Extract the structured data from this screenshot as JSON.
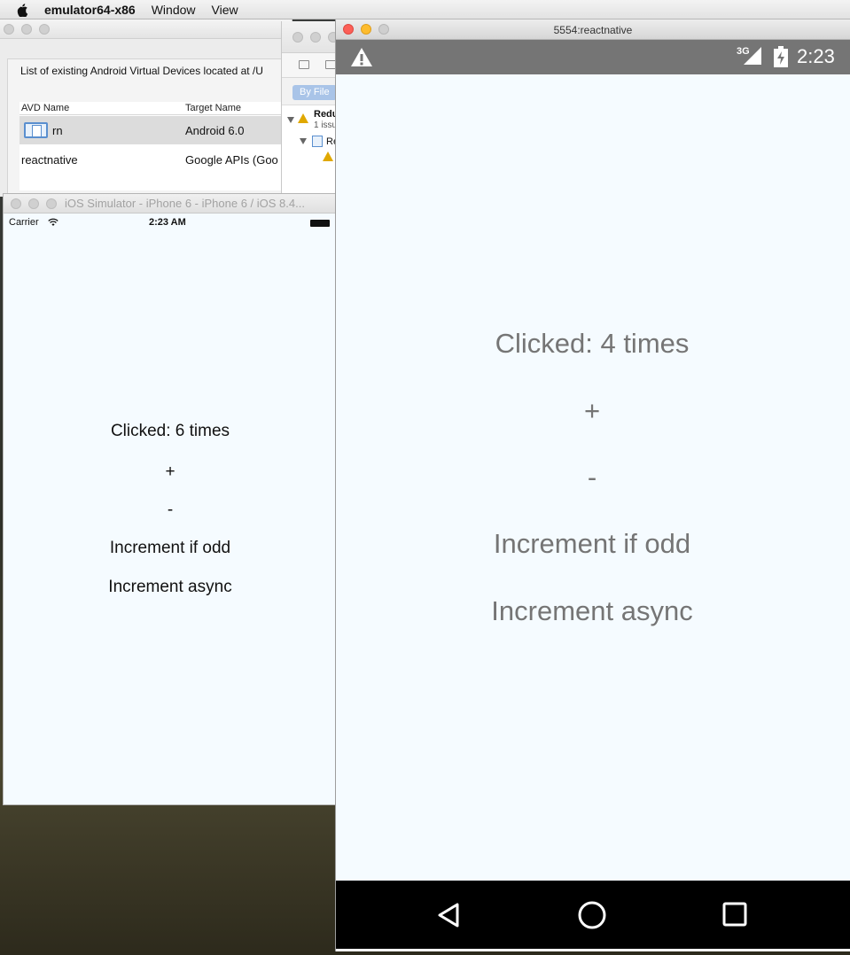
{
  "menubar": {
    "app_name": "emulator64-x86",
    "items": [
      "Window",
      "View"
    ]
  },
  "avd_manager": {
    "caption": "List of existing Android Virtual Devices located at /U",
    "columns": [
      "AVD Name",
      "Target Name"
    ],
    "rows": [
      {
        "name": "rn",
        "target": "Android 6.0"
      },
      {
        "name": "reactnative",
        "target": "Google APIs (Goo"
      }
    ]
  },
  "xcode": {
    "filter_label": "By File",
    "lines": [
      "Redu",
      "1 issu",
      "Re"
    ]
  },
  "ios_simulator": {
    "title": "iOS Simulator - iPhone 6 - iPhone 6 / iOS 8.4...",
    "carrier": "Carrier",
    "time": "2:23 AM",
    "clicked_text": "Clicked: 6 times",
    "plus_label": "+",
    "minus_label": "-",
    "increment_odd_label": "Increment if odd",
    "increment_async_label": "Increment async"
  },
  "android_emulator": {
    "title": "5554:reactnative",
    "network": "3G",
    "time": "2:23",
    "clicked_text": "Clicked: 4 times",
    "plus_label": "+",
    "minus_label": "-",
    "increment_odd_label": "Increment if odd",
    "increment_async_label": "Increment async",
    "nav_icons": [
      "back-icon",
      "home-icon",
      "recents-icon"
    ]
  },
  "colors": {
    "app_background": "#f5fbff",
    "android_text": "#757575",
    "android_statusbar": "#757575",
    "selection_blue": "#a9c4e8"
  }
}
